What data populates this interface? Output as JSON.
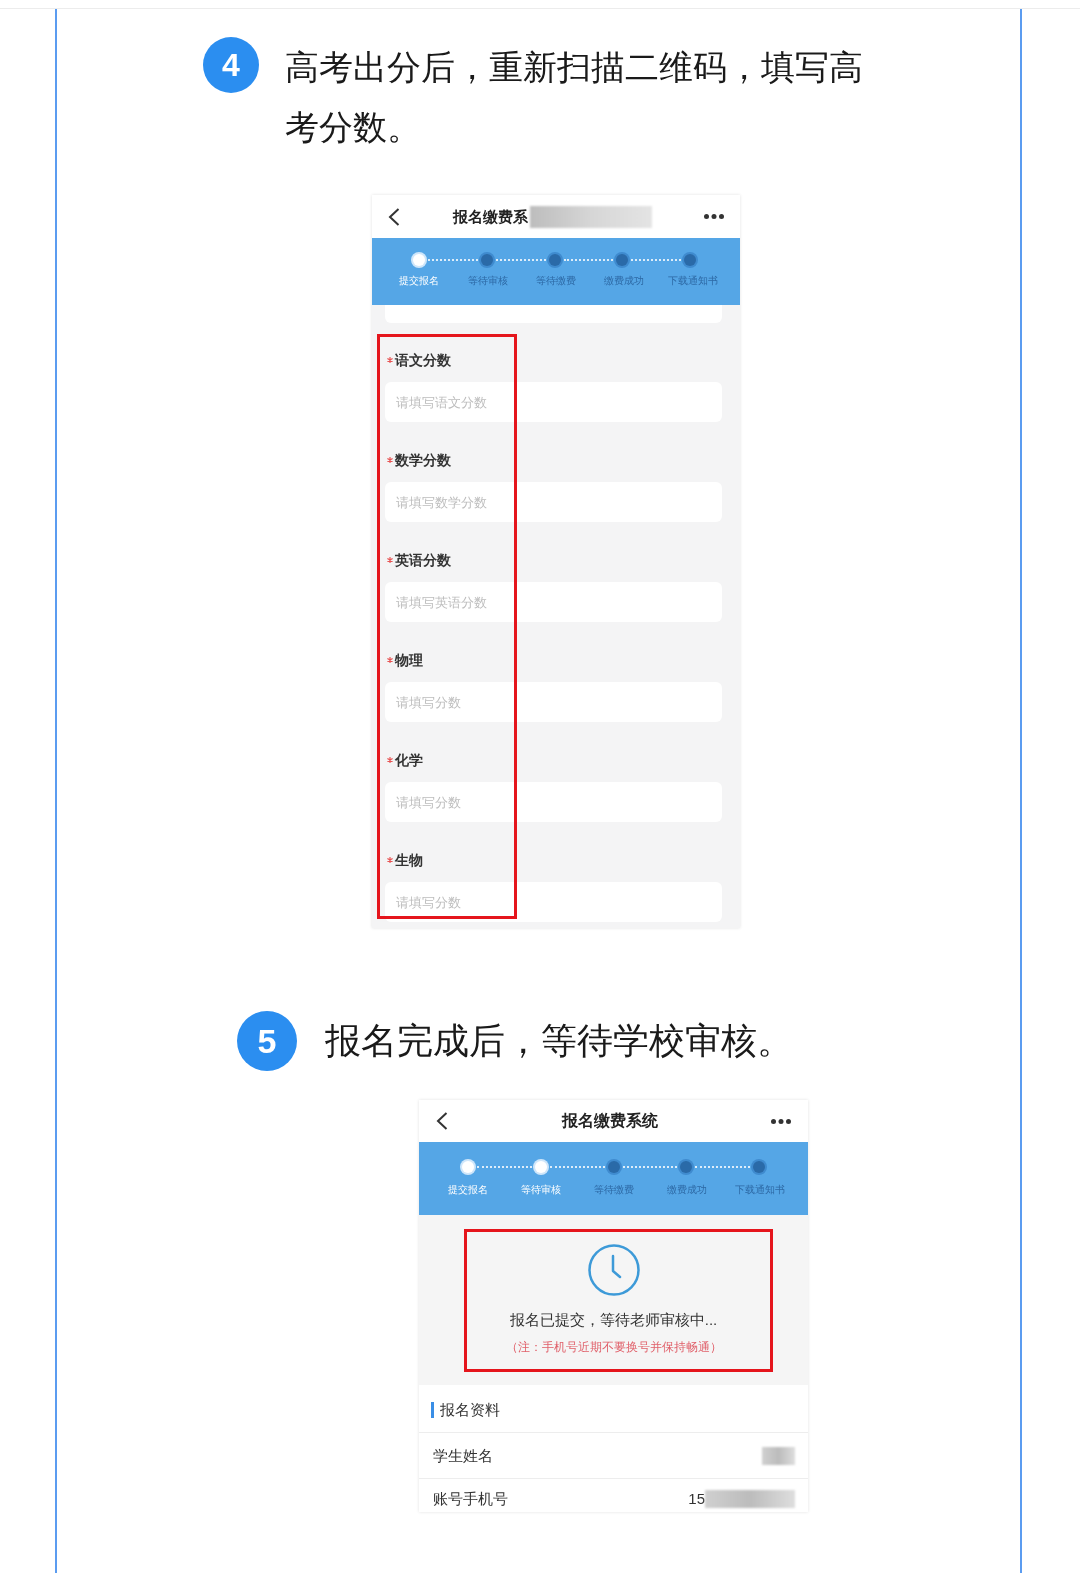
{
  "sections": [
    {
      "number": "4",
      "instruction": "高考出分后，重新扫描二维码，填写高考分数。",
      "phone": {
        "kind": "form",
        "title": "报名缴费系",
        "title_redacted": true,
        "steps": [
          {
            "label": "提交报名",
            "done": true
          },
          {
            "label": "等待审核",
            "done": false
          },
          {
            "label": "等待缴费",
            "done": false
          },
          {
            "label": "缴费成功",
            "done": false
          },
          {
            "label": "下载通知书",
            "done": false
          }
        ],
        "highlighted": true,
        "fields": [
          {
            "label": "语文分数",
            "required": true,
            "placeholder": "请填写语文分数"
          },
          {
            "label": "数学分数",
            "required": true,
            "placeholder": "请填写数学分数"
          },
          {
            "label": "英语分数",
            "required": true,
            "placeholder": "请填写英语分数"
          },
          {
            "label": "物理",
            "required": true,
            "placeholder": "请填写分数"
          },
          {
            "label": "化学",
            "required": true,
            "placeholder": "请填写分数"
          },
          {
            "label": "生物",
            "required": true,
            "placeholder": "请填写分数"
          }
        ]
      }
    },
    {
      "number": "5",
      "instruction": "报名完成后，等待学校审核。",
      "phone": {
        "kind": "status",
        "title": "报名缴费系统",
        "steps": [
          {
            "label": "提交报名",
            "done": true
          },
          {
            "label": "等待审核",
            "done": true
          },
          {
            "label": "等待缴费",
            "done": false
          },
          {
            "label": "缴费成功",
            "done": false
          },
          {
            "label": "下载通知书",
            "done": false
          }
        ],
        "status": {
          "message": "报名已提交，等待老师审核中...",
          "note": "（注：手机号近期不要换号并保持畅通）",
          "highlighted": true
        },
        "details": {
          "title": "报名资料",
          "rows": [
            {
              "label": "学生姓名",
              "value_redacted": true
            },
            {
              "label": "账号手机号",
              "value": "15",
              "value_redacted": true
            }
          ]
        }
      }
    }
  ]
}
